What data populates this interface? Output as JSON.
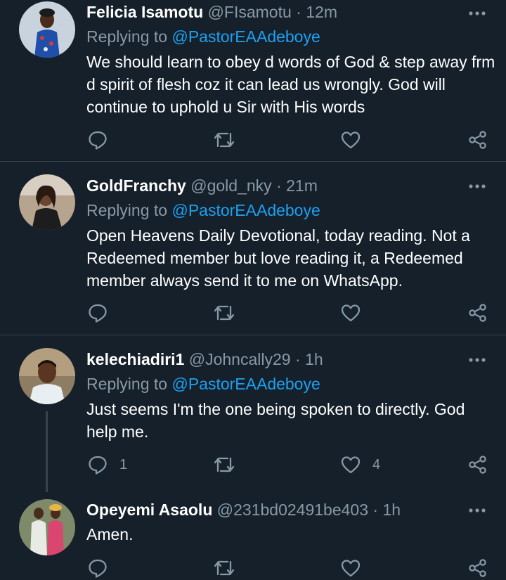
{
  "tweets": [
    {
      "name": "Felicia Isamotu",
      "handle": "@FIsamotu",
      "time": "12m",
      "replying_label": "Replying to",
      "mention": "@PastorEAAdeboye",
      "text": "We should learn to obey d words of God & step away frm d spirit of flesh coz it can lead us wrongly. God will continue to uphold u Sir with His words",
      "replies": "",
      "likes": ""
    },
    {
      "name": "GoldFranchy",
      "handle": "@gold_nky",
      "time": "21m",
      "replying_label": "Replying to",
      "mention": "@PastorEAAdeboye",
      "text": "Open Heavens Daily Devotional, today reading. Not a Redeemed member but love reading it, a Redeemed member always send it to me on WhatsApp.",
      "replies": "",
      "likes": ""
    },
    {
      "name": "kelechiadiri1",
      "handle": "@Johncally29",
      "time": "1h",
      "replying_label": "Replying to",
      "mention": "@PastorEAAdeboye",
      "text": "Just seems I'm the one being spoken to directly. God help me.",
      "replies": "1",
      "likes": "4"
    },
    {
      "name": "Opeyemi Asaolu",
      "handle": "@231bd02491be403",
      "time": "1h",
      "text": "Amen.",
      "replies": "",
      "likes": ""
    }
  ],
  "separator": "·",
  "colors": {
    "background": "#15202b",
    "text": "#ffffff",
    "muted": "#8899a6",
    "link": "#1da1f2",
    "divider": "#38444d"
  },
  "icons": [
    "reply-icon",
    "retweet-icon",
    "like-icon",
    "share-icon",
    "more-options-icon"
  ]
}
